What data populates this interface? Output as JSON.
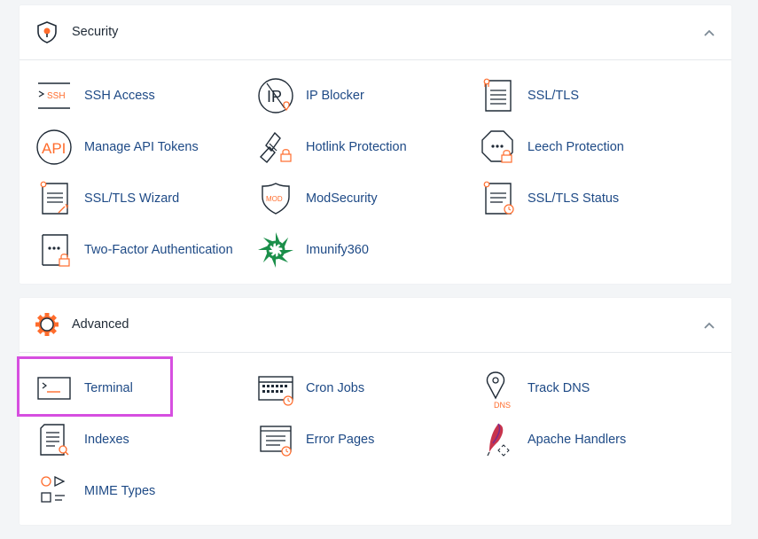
{
  "colors": {
    "link": "#1e4a86",
    "accent": "#ff6c2c",
    "highlight": "#d64fe0"
  },
  "security": {
    "title": "Security",
    "icon": "shield-icon",
    "items": [
      {
        "label": "SSH Access",
        "icon": "ssh-icon",
        "badge": "SSH"
      },
      {
        "label": "IP Blocker",
        "icon": "ip-blocker-icon",
        "badge": "IP"
      },
      {
        "label": "SSL/TLS",
        "icon": "certificate-icon"
      },
      {
        "label": "Manage API Tokens",
        "icon": "api-icon",
        "badge": "API"
      },
      {
        "label": "Hotlink Protection",
        "icon": "chain-lock-icon"
      },
      {
        "label": "Leech Protection",
        "icon": "octagon-lock-icon"
      },
      {
        "label": "SSL/TLS Wizard",
        "icon": "certificate-wand-icon"
      },
      {
        "label": "ModSecurity",
        "icon": "mod-shield-icon",
        "badge": "MOD"
      },
      {
        "label": "SSL/TLS Status",
        "icon": "certificate-clock-icon"
      },
      {
        "label": "Two-Factor Authentication",
        "icon": "password-lock-icon"
      },
      {
        "label": "Imunify360",
        "icon": "imunify-icon"
      }
    ]
  },
  "advanced": {
    "title": "Advanced",
    "icon": "gear-icon",
    "items": [
      {
        "label": "Terminal",
        "icon": "terminal-icon"
      },
      {
        "label": "Cron Jobs",
        "icon": "calendar-clock-icon"
      },
      {
        "label": "Track DNS",
        "icon": "dns-pin-icon",
        "badge": "DNS"
      },
      {
        "label": "Indexes",
        "icon": "document-search-icon"
      },
      {
        "label": "Error Pages",
        "icon": "document-clock-icon"
      },
      {
        "label": "Apache Handlers",
        "icon": "feather-icon"
      },
      {
        "label": "MIME Types",
        "icon": "shapes-icon"
      }
    ]
  }
}
